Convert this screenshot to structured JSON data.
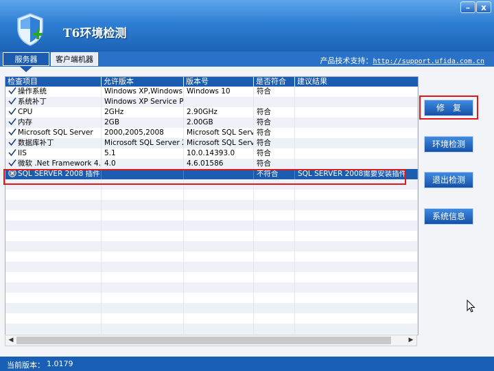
{
  "window": {
    "title": "T6环境检测",
    "minimize_label": "–",
    "close_label": "x"
  },
  "tabs": [
    {
      "label": "服务器"
    },
    {
      "label": "客户端机器"
    }
  ],
  "support": {
    "label": "产品技术支持：",
    "url": "http://support.ufida.com.cn"
  },
  "table": {
    "headers": [
      "检查项目",
      "允许版本",
      "版本号",
      "是否符合",
      "建议结果"
    ],
    "rows": [
      {
        "status": "ok",
        "item": "操作系统",
        "allowed": "Windows XP,Windows ...",
        "version": "Windows 10",
        "match": "符合",
        "advice": ""
      },
      {
        "status": "ok",
        "item": "系统补丁",
        "allowed": "Windows XP Service P...",
        "version": "",
        "match": "",
        "advice": ""
      },
      {
        "status": "ok",
        "item": "CPU",
        "allowed": "2GHz",
        "version": "2.90GHz",
        "match": "符合",
        "advice": ""
      },
      {
        "status": "ok",
        "item": "内存",
        "allowed": "2GB",
        "version": "2.00GB",
        "match": "符合",
        "advice": ""
      },
      {
        "status": "ok",
        "item": "Microsoft SQL Server",
        "allowed": "2000,2005,2008",
        "version": "Microsoft SQL Serv...",
        "match": "符合",
        "advice": ""
      },
      {
        "status": "ok",
        "item": "数据库补丁",
        "allowed": "Microsoft SQL Server 2...",
        "version": "Microsoft SQL Serv...",
        "match": "符合",
        "advice": ""
      },
      {
        "status": "ok",
        "item": "IIS",
        "allowed": "5.1",
        "version": "10.0.14393.0",
        "match": "符合",
        "advice": ""
      },
      {
        "status": "ok",
        "item": "微软 .Net Framework 4.0",
        "allowed": "4.0",
        "version": "4.6.01586",
        "match": "符合",
        "advice": ""
      },
      {
        "status": "fail",
        "item": "SQL SERVER 2008 插件",
        "allowed": "",
        "version": "",
        "match": "不符合",
        "advice": "SQL SERVER 2008需要安装插件"
      }
    ]
  },
  "buttons": {
    "fix": "修　复",
    "env_check": "环境检测",
    "exit_check": "退出检测",
    "sys_info": "系统信息"
  },
  "status": {
    "label": "当前版本：",
    "version": "1.0179"
  },
  "colors": {
    "accent": "#1c5cb0",
    "highlight": "#e01818"
  }
}
